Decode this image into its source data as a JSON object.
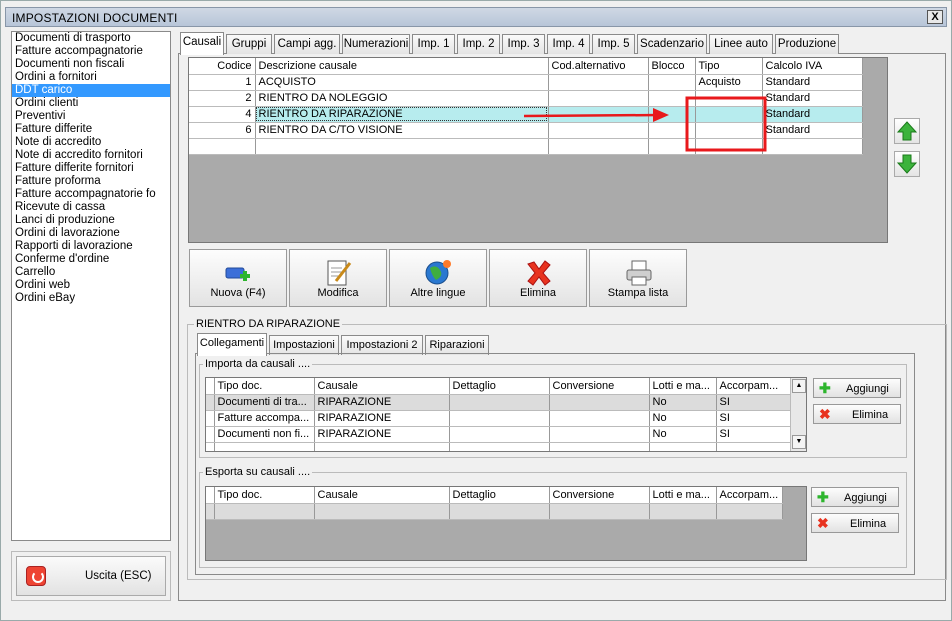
{
  "window": {
    "title": "IMPOSTAZIONI DOCUMENTI",
    "close_glyph": "X"
  },
  "sidebar": {
    "items": [
      {
        "label": "Documenti di trasporto"
      },
      {
        "label": "Fatture accompagnatorie"
      },
      {
        "label": "Documenti non fiscali"
      },
      {
        "label": "Ordini a fornitori"
      },
      {
        "label": "DDT carico",
        "selected": true
      },
      {
        "label": "Ordini clienti"
      },
      {
        "label": "Preventivi"
      },
      {
        "label": "Fatture differite"
      },
      {
        "label": "Note di accredito"
      },
      {
        "label": "Note di accredito fornitori"
      },
      {
        "label": "Fatture differite fornitori"
      },
      {
        "label": "Fatture proforma"
      },
      {
        "label": "Fatture accompagnatorie fo"
      },
      {
        "label": "Ricevute di cassa"
      },
      {
        "label": "Lanci di produzione"
      },
      {
        "label": "Ordini di lavorazione"
      },
      {
        "label": "Rapporti di lavorazione"
      },
      {
        "label": "Conferme d'ordine"
      },
      {
        "label": "Carrello"
      },
      {
        "label": "Ordini web"
      },
      {
        "label": "Ordini eBay"
      }
    ]
  },
  "exit": {
    "label": "Uscita (ESC)"
  },
  "tabs": [
    {
      "label": "Causali",
      "active": true
    },
    {
      "label": "Gruppi"
    },
    {
      "label": "Campi agg."
    },
    {
      "label": "Numerazioni"
    },
    {
      "label": "Imp. 1"
    },
    {
      "label": "Imp. 2"
    },
    {
      "label": "Imp. 3"
    },
    {
      "label": "Imp. 4"
    },
    {
      "label": "Imp. 5"
    },
    {
      "label": "Scadenzario"
    },
    {
      "label": "Linee auto"
    },
    {
      "label": "Produzione"
    }
  ],
  "causali_grid": {
    "headers": [
      "Codice",
      "Descrizione causale",
      "Cod.alternativo",
      "Blocco",
      "Tipo",
      "Calcolo IVA"
    ],
    "rows": [
      {
        "codice": "1",
        "descrizione": "ACQUISTO",
        "cod_alt": "",
        "blocco": "",
        "tipo": "Acquisto",
        "iva": "Standard"
      },
      {
        "codice": "2",
        "descrizione": "RIENTRO DA NOLEGGIO",
        "cod_alt": "",
        "blocco": "",
        "tipo": "",
        "iva": "Standard"
      },
      {
        "codice": "4",
        "descrizione": "RIENTRO DA RIPARAZIONE",
        "cod_alt": "",
        "blocco": "",
        "tipo": "",
        "iva": "Standard",
        "selected": true
      },
      {
        "codice": "6",
        "descrizione": "RIENTRO DA C/TO VISIONE",
        "cod_alt": "",
        "blocco": "",
        "tipo": "",
        "iva": "Standard"
      }
    ]
  },
  "actions": {
    "nuova": "Nuova (F4)",
    "modifica": "Modifica",
    "altre_lingue": "Altre lingue",
    "elimina": "Elimina",
    "stampa": "Stampa lista"
  },
  "detail": {
    "group_title": "RIENTRO DA RIPARAZIONE",
    "tabs": [
      {
        "label": "Collegamenti",
        "active": true
      },
      {
        "label": "Impostazioni"
      },
      {
        "label": "Impostazioni 2"
      },
      {
        "label": "Riparazioni"
      }
    ],
    "importa": {
      "title": "Importa da causali ....",
      "headers": [
        "Tipo doc.",
        "Causale",
        "Dettaglio",
        "Conversione",
        "Lotti e ma...",
        "Accorpam..."
      ],
      "rows": [
        {
          "tipo": "Documenti di tra...",
          "causale": "RIPARAZIONE",
          "dettaglio": "",
          "conversione": "",
          "lotti": "No",
          "accorp": "SI"
        },
        {
          "tipo": "Fatture accompa...",
          "causale": "RIPARAZIONE",
          "dettaglio": "",
          "conversione": "",
          "lotti": "No",
          "accorp": "SI"
        },
        {
          "tipo": "Documenti non fi...",
          "causale": "RIPARAZIONE",
          "dettaglio": "",
          "conversione": "",
          "lotti": "No",
          "accorp": "SI"
        }
      ],
      "aggiungi": "Aggiungi",
      "elimina": "Elimina"
    },
    "esporta": {
      "title": "Esporta su causali ....",
      "headers": [
        "Tipo doc.",
        "Causale",
        "Dettaglio",
        "Conversione",
        "Lotti e ma...",
        "Accorpam..."
      ],
      "aggiungi": "Aggiungi",
      "elimina": "Elimina"
    }
  },
  "colors": {
    "selection": "#3399ff",
    "row_highlight": "#b7ecee",
    "annotation": "#e8191c"
  }
}
